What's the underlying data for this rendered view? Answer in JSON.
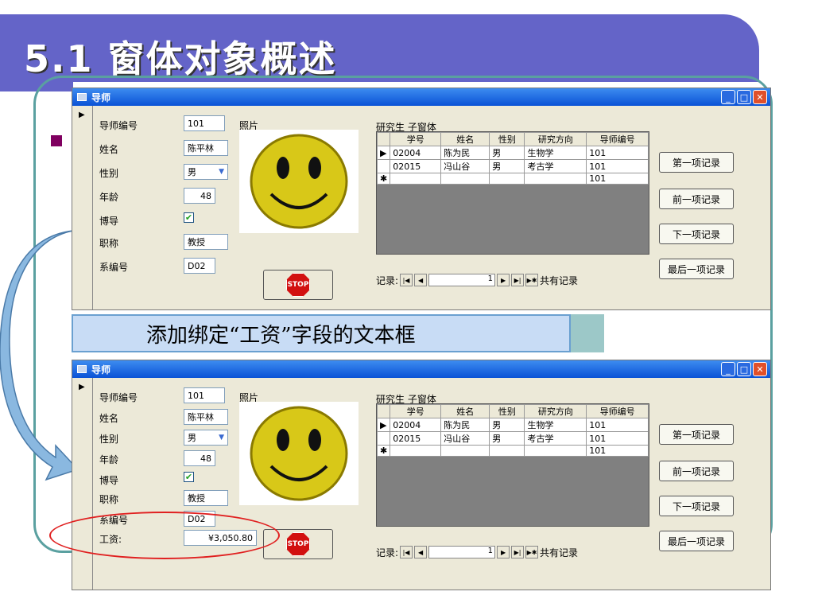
{
  "slide": {
    "title": "5.1  窗体对象概述"
  },
  "banner": {
    "text": "添加绑定“工资”字段的文本框"
  },
  "windows": [
    {
      "title": "导师",
      "fields": {
        "id_label": "导师编号",
        "id": "101",
        "name_label": "姓名",
        "name": "陈平林",
        "gender_label": "性别",
        "gender": "男",
        "age_label": "年龄",
        "age": "48",
        "phd_label": "博导",
        "phd_checked": true,
        "title_label": "职称",
        "title": "教授",
        "dept_label": "系编号",
        "dept": "D02",
        "photo_label": "照片"
      },
      "subform": {
        "title": "研究生 子窗体",
        "columns": [
          "学号",
          "姓名",
          "性别",
          "研究方向",
          "导师编号"
        ],
        "rows": [
          [
            "02004",
            "陈为民",
            "男",
            "生物学",
            "101"
          ],
          [
            "02015",
            "冯山谷",
            "男",
            "考古学",
            "101"
          ],
          [
            "",
            "",
            "",
            "",
            "101"
          ]
        ],
        "nav_label": "记录:",
        "nav_value": "1",
        "nav_total": "共有记录"
      },
      "buttons": [
        "第一项记录",
        "前一项记录",
        "下一项记录",
        "最后一项记录"
      ],
      "stop": "STOP"
    },
    {
      "title": "导师",
      "fields": {
        "id_label": "导师编号",
        "id": "101",
        "name_label": "姓名",
        "name": "陈平林",
        "gender_label": "性别",
        "gender": "男",
        "age_label": "年龄",
        "age": "48",
        "phd_label": "博导",
        "phd_checked": true,
        "title_label": "职称",
        "title": "教授",
        "dept_label": "系编号",
        "dept": "D02",
        "salary_label": "工资:",
        "salary": "¥3,050.80",
        "photo_label": "照片"
      },
      "subform": {
        "title": "研究生 子窗体",
        "columns": [
          "学号",
          "姓名",
          "性别",
          "研究方向",
          "导师编号"
        ],
        "rows": [
          [
            "02004",
            "陈为民",
            "男",
            "生物学",
            "101"
          ],
          [
            "02015",
            "冯山谷",
            "男",
            "考古学",
            "101"
          ],
          [
            "",
            "",
            "",
            "",
            "101"
          ]
        ],
        "nav_label": "记录:",
        "nav_value": "1",
        "nav_total": "共有记录"
      },
      "buttons": [
        "第一项记录",
        "前一项记录",
        "下一项记录",
        "最后一项记录"
      ],
      "stop": "STOP"
    }
  ]
}
